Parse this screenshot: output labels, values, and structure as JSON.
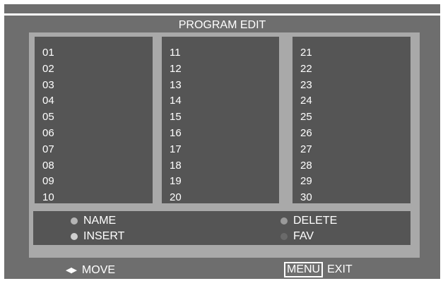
{
  "title": "PROGRAM EDIT",
  "columns": [
    [
      "01",
      "02",
      "03",
      "04",
      "05",
      "06",
      "07",
      "08",
      "09",
      "10"
    ],
    [
      "11",
      "12",
      "13",
      "14",
      "15",
      "16",
      "17",
      "18",
      "19",
      "20"
    ],
    [
      "21",
      "22",
      "23",
      "24",
      "25",
      "26",
      "27",
      "28",
      "29",
      "30"
    ]
  ],
  "legend": {
    "name": {
      "label": "NAME",
      "color": "#b5b5b5"
    },
    "insert": {
      "label": "INSERT",
      "color": "#cfcfcf"
    },
    "delete": {
      "label": "DELETE",
      "color": "#9a9a9a"
    },
    "fav": {
      "label": "FAV",
      "color": "#6a6a6a"
    }
  },
  "footer": {
    "move_icon": "left-right-arrows-icon",
    "move_label": "MOVE",
    "menu_key": "MENU",
    "exit_label": "EXIT"
  }
}
